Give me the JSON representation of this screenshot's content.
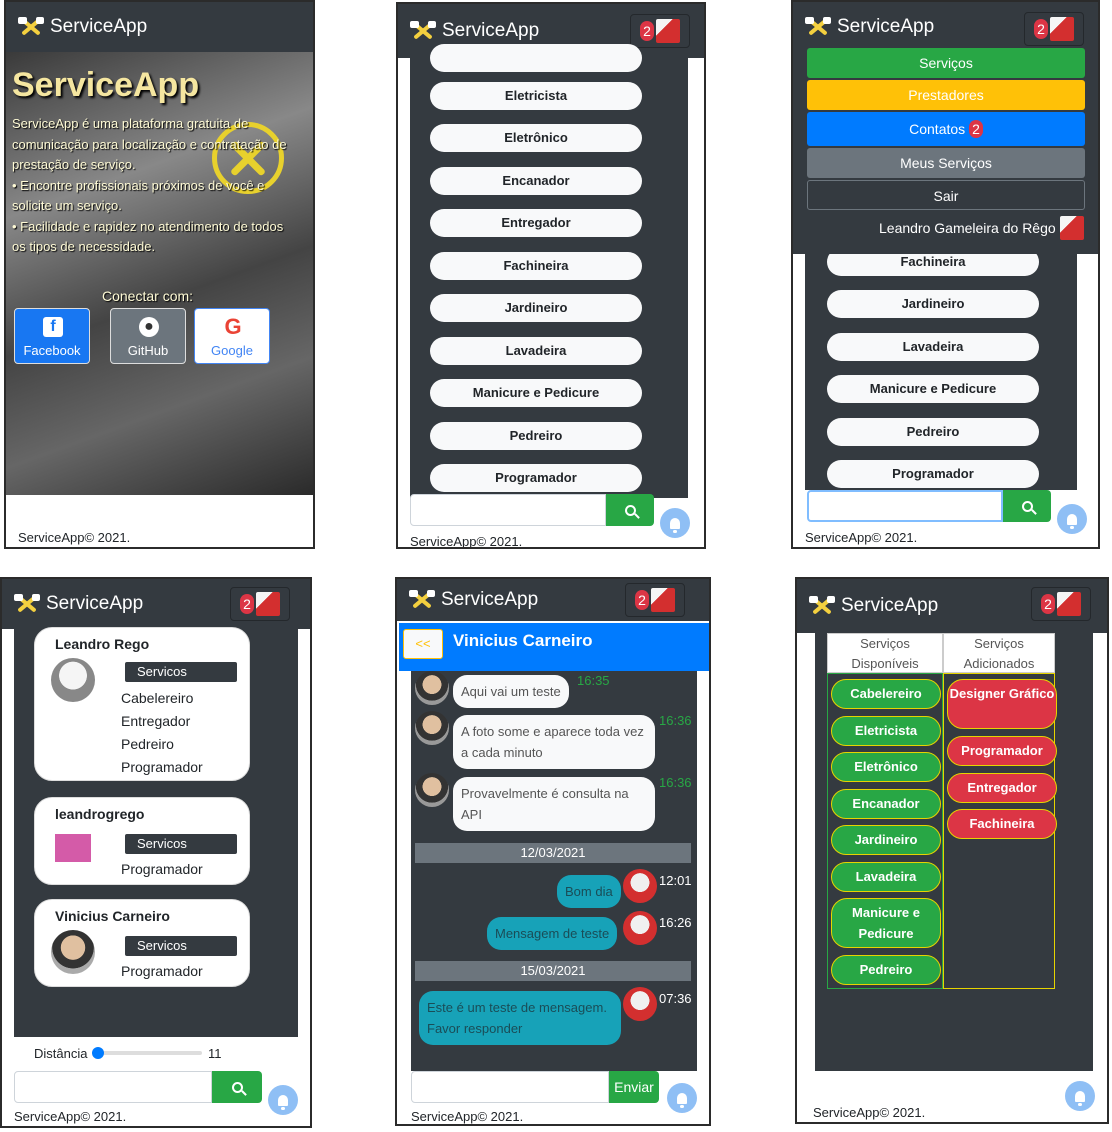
{
  "app": {
    "name": "ServiceApp",
    "footer": "ServiceApp© 2021.",
    "badge": "2"
  },
  "login": {
    "hero_title": "ServiceApp",
    "intro": "ServiceApp é uma plataforma gratuita de comunicação para localização e contratação de prestação de serviço.",
    "bullet1": "•    Encontre profissionais próximos de você e solicite um serviço.",
    "bullet2": "•    Facilidade e rapidez no atendimento de todos os tipos de necessidade.",
    "connect": "Conectar com:",
    "facebook": "Facebook",
    "github": "GitHub",
    "google": "Google"
  },
  "services_list": {
    "items": [
      "Eletricista",
      "Eletrônico",
      "Encanador",
      "Entregador",
      "Fachineira",
      "Jardineiro",
      "Lavadeira",
      "Manicure e Pedicure",
      "Pedreiro",
      "Programador"
    ]
  },
  "menu": {
    "servicos": "Serviços",
    "prestadores": "Prestadores",
    "contatos": "Contatos",
    "contatos_badge": "2",
    "meus_servicos": "Meus Serviços",
    "sair": "Sair",
    "user_name": "Leandro Gameleira do Rêgo",
    "list": [
      "Fachineira",
      "Jardineiro",
      "Lavadeira",
      "Manicure e Pedicure",
      "Pedreiro",
      "Programador"
    ]
  },
  "providers": {
    "cards": [
      {
        "name": "Leandro Rego",
        "tag": "Servicos",
        "services": [
          "Cabelereiro",
          "Entregador",
          "Pedreiro",
          "Programador"
        ]
      },
      {
        "name": "leandrogrego",
        "tag": "Servicos",
        "services": [
          "Programador"
        ]
      },
      {
        "name": "Vinicius Carneiro",
        "tag": "Servicos",
        "services": [
          "Programador"
        ]
      }
    ],
    "distance_label": "Distância",
    "distance_value": "11"
  },
  "chat": {
    "back": "<<",
    "contact": "Vinicius Carneiro",
    "messages": [
      {
        "text": "Aqui vai um teste",
        "time": "16:35"
      },
      {
        "text": "A foto some e aparece toda vez a cada minuto",
        "time": "16:36"
      },
      {
        "text": "Provavelmente é consulta na API",
        "time": "16:36"
      }
    ],
    "date1": "12/03/2021",
    "mine1": [
      {
        "text": "Bom dia",
        "time": "12:01"
      },
      {
        "text": "Mensagem de teste",
        "time": "16:26"
      }
    ],
    "date2": "15/03/2021",
    "mine2": [
      {
        "text": "Este é um teste de mensagem. Favor responder",
        "time": "07:36"
      }
    ],
    "send": "Enviar"
  },
  "manage": {
    "col1": "Serviços Disponíveis",
    "col2": "Serviços Adicionados",
    "available": [
      "Cabelereiro",
      "Eletricista",
      "Eletrônico",
      "Encanador",
      "Jardineiro",
      "Lavadeira",
      "Manicure e Pedicure",
      "Pedreiro"
    ],
    "added": [
      "Designer Gráfico",
      "Programador",
      "Entregador",
      "Fachineira"
    ]
  }
}
